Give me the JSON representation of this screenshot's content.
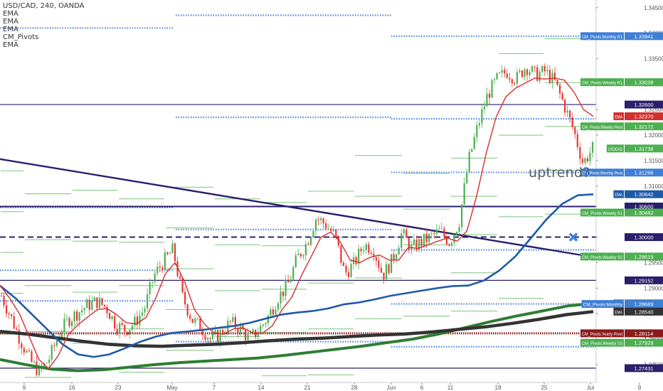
{
  "header": {
    "symbol_line": "USD/CAD, 240, OANDA",
    "indicators": [
      "EMA",
      "EMA",
      "EMA",
      "CM_Pivots",
      "EMA"
    ]
  },
  "annotation": {
    "text": "uptrend?"
  },
  "chart_data": {
    "type": "candlestick",
    "symbol": "USD/CAD",
    "timeframe": "240",
    "source": "OANDA",
    "ylim": [
      1.2715,
      1.3465
    ],
    "x_ticks": [
      "9",
      "16",
      "23",
      "May",
      "7",
      "14",
      "21",
      "28",
      "Jun",
      "6",
      "11",
      "18",
      "25",
      "Jul",
      "9"
    ],
    "y_ticks": [
      "1.34500",
      "1.34000",
      "1.33500",
      "1.33000",
      "1.32500",
      "1.32000",
      "1.31500",
      "1.31000",
      "1.30500",
      "1.30000",
      "1.29500",
      "1.29000",
      "1.28500",
      "1.28000",
      "1.27500"
    ],
    "price_tags": [
      {
        "label": "CM_Pivots:Monthly R1",
        "value": "1.33941",
        "color": "#3f7fd6"
      },
      {
        "label": "CM_Pivots:Weekly R1",
        "value": "1.33038",
        "color": "#4caf50"
      },
      {
        "label": "",
        "value": "1.32600",
        "color": "#2a1f6b"
      },
      {
        "label": "EMA",
        "value": "1.32370",
        "color": "#d32f2f"
      },
      {
        "label": "CM_Pivots:Weekly Pivot",
        "value": "1.32172",
        "color": "#4caf50"
      },
      {
        "label": "USDCAD",
        "value": "1.31738",
        "color": "#4caf50"
      },
      {
        "label": "CM_Pivots:Monthly Pivot",
        "value": "1.31266",
        "color": "#3f7fd6"
      },
      {
        "label": "EMA",
        "value": "1.30842",
        "color": "#1e5aa8"
      },
      {
        "label": "",
        "value": "1.30600",
        "color": "#2a1f6b"
      },
      {
        "label": "CM_Pivots:Weekly S1",
        "value": "1.30482",
        "color": "#4caf50"
      },
      {
        "label": "",
        "value": "1.30000",
        "color": "#2a1f6b"
      },
      {
        "label": "CM_Pivots:Weekly S2",
        "value": "1.29619",
        "color": "#4caf50"
      },
      {
        "label": "",
        "value": "1.29152",
        "color": "#2a1f6b"
      },
      {
        "label": "EMA",
        "value": "1.28700",
        "color": "#2e7d32"
      },
      {
        "label": "CM_Pivots:Monthly",
        "value": "1.28689",
        "color": "#3f7fd6"
      },
      {
        "label": "EMA",
        "value": "1.28540",
        "color": "#333333"
      },
      {
        "label": "CM_Pivots:Yearly Pivot",
        "value": "1.28114",
        "color": "#8b1a1a"
      },
      {
        "label": "CM_Pivots:Weekly S3",
        "value": "1.27929",
        "color": "#4caf50"
      },
      {
        "label": "",
        "value": "1.27431",
        "color": "#2a1f6b"
      }
    ],
    "price_series": [
      1.2885,
      1.2843,
      1.2798,
      1.2758,
      1.2735,
      1.2762,
      1.2808,
      1.2838,
      1.2852,
      1.2866,
      1.2874,
      1.2862,
      1.2828,
      1.2818,
      1.2832,
      1.286,
      1.2925,
      1.2952,
      1.2975,
      1.2882,
      1.2838,
      1.2822,
      1.2798,
      1.2812,
      1.2832,
      1.2822,
      1.28,
      1.2818,
      1.2845,
      1.2882,
      1.2905,
      1.2958,
      1.2988,
      1.3038,
      1.3025,
      1.3002,
      1.2928,
      1.2948,
      1.2985,
      1.2978,
      1.2925,
      1.2955,
      1.3008,
      1.2978,
      1.299,
      1.3,
      1.3012,
      1.299,
      1.303,
      1.315,
      1.322,
      1.328,
      1.331,
      1.3325,
      1.331,
      1.3335,
      1.3318,
      1.3325,
      1.3305,
      1.326,
      1.321,
      1.3145,
      1.3174
    ],
    "ema_red": [
      1.2905,
      1.288,
      1.285,
      1.2805,
      1.276,
      1.2742,
      1.2768,
      1.2808,
      1.2828,
      1.2843,
      1.2858,
      1.286,
      1.2848,
      1.2832,
      1.283,
      1.2842,
      1.288,
      1.2928,
      1.295,
      1.2912,
      1.2858,
      1.283,
      1.2812,
      1.281,
      1.282,
      1.2822,
      1.2812,
      1.2812,
      1.2826,
      1.2858,
      1.2882,
      1.2925,
      1.2962,
      1.3,
      1.301,
      1.299,
      1.2955,
      1.295,
      1.296,
      1.2965,
      1.2955,
      1.2955,
      1.298,
      1.2978,
      1.2985,
      1.2992,
      1.2998,
      1.2992,
      1.3012,
      1.308,
      1.3165,
      1.3235,
      1.3275,
      1.3292,
      1.3302,
      1.3312,
      1.331,
      1.3312,
      1.3308,
      1.3285,
      1.325,
      1.3237
    ],
    "ema_blue": [
      1.2905,
      1.288,
      1.285,
      1.282,
      1.279,
      1.277,
      1.2765,
      1.277,
      1.2782,
      1.2795,
      1.2805,
      1.2812,
      1.2815,
      1.2818,
      1.2822,
      1.2826,
      1.2832,
      1.284,
      1.2848,
      1.2852,
      1.2855,
      1.286,
      1.2868,
      1.2872,
      1.2878,
      1.2885,
      1.289,
      1.2895,
      1.29,
      1.2904,
      1.2905,
      1.2915,
      1.2935,
      1.2962,
      1.2998,
      1.3035,
      1.3065,
      1.3082,
      1.3084
    ],
    "ema_black": [
      1.2815,
      1.281,
      1.2803,
      1.2796,
      1.279,
      1.2787,
      1.2786,
      1.2788,
      1.279,
      1.2793,
      1.2797,
      1.28,
      1.2802,
      1.2805,
      1.2808,
      1.281,
      1.2814,
      1.2819,
      1.2824,
      1.2831,
      1.2839,
      1.2848,
      1.2854
    ],
    "ema_green": [
      1.276,
      1.275,
      1.2741,
      1.2738,
      1.274,
      1.2745,
      1.275,
      1.2754,
      1.2757,
      1.276,
      1.2763,
      1.2768,
      1.2774,
      1.278,
      1.2786,
      1.2793,
      1.28,
      1.281,
      1.2822,
      1.2834,
      1.2845,
      1.2855,
      1.2865,
      1.287
    ],
    "trendline": {
      "from": 1.3153,
      "to": 1.296
    },
    "horizontal_levels": [
      1.326,
      1.306,
      1.3,
      1.29152,
      1.27431
    ],
    "crossed_marker_at": 1.3
  }
}
